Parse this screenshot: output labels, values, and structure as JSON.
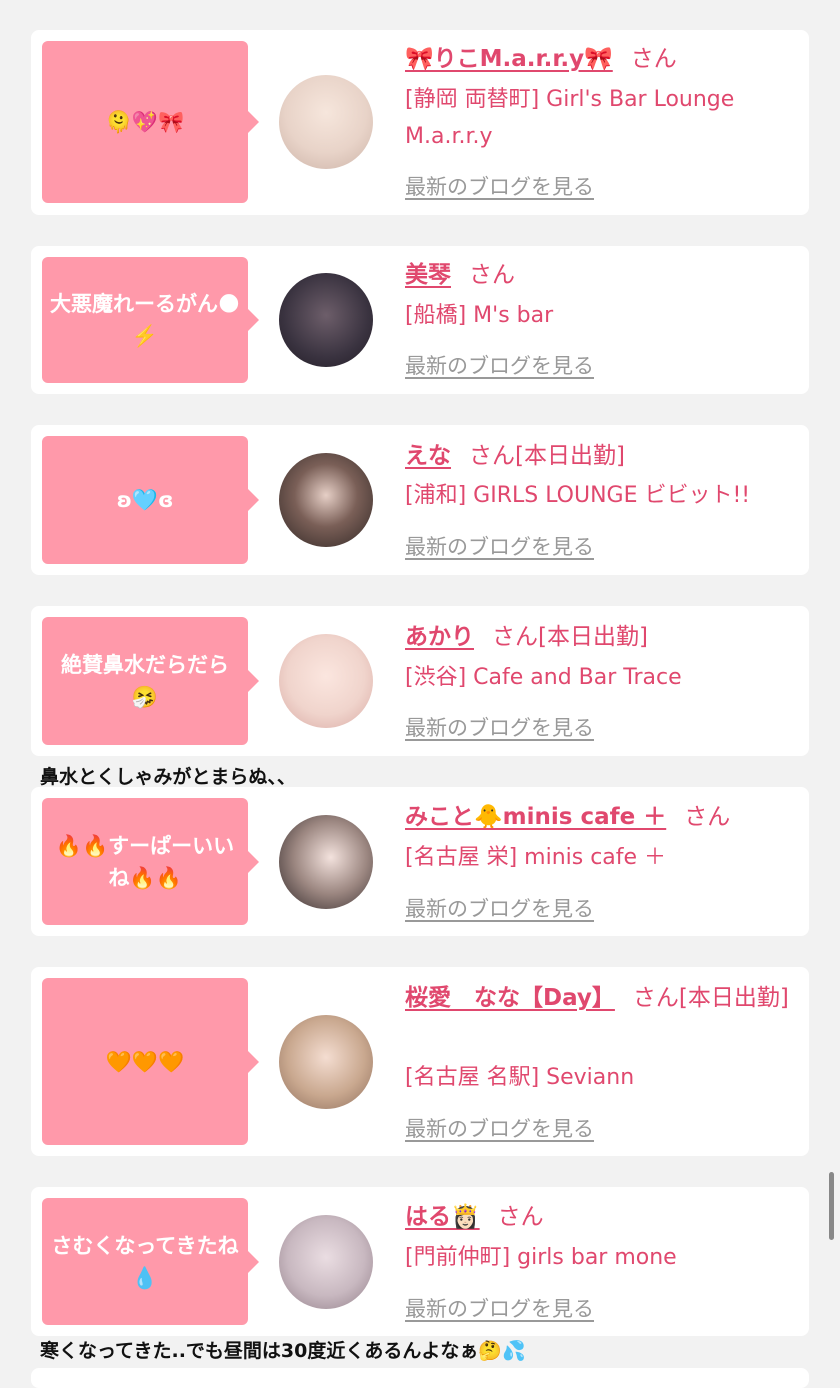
{
  "entries": [
    {
      "bubble": "🫠💖🎀",
      "name": "🎀りこM.a.r.r.y🎀",
      "suffix": "さん",
      "shop": "[静岡 両替町] Girl's Bar Lounge M.a.r.r.y",
      "blog": "最新のブログを見る",
      "avatar": "#e8d3c8"
    },
    {
      "bubble": "大悪魔れーるがん🌑⚡️",
      "name": "美琴",
      "suffix": "さん",
      "shop": "[船橋] M's bar",
      "blog": "最新のブログを見る",
      "avatar": "#3a3340"
    },
    {
      "bubble": "ʚ🩵ɞ",
      "name": "えな",
      "suffix": "さん[本日出勤]",
      "shop": "[浦和] GIRLS LOUNGE ビビット!!",
      "blog": "最新のブログを見る",
      "avatar": "#4a3a36"
    },
    {
      "bubble": "絶賛鼻水だらだら🤧",
      "name": "あかり",
      "suffix": "さん[本日出勤]",
      "shop": "[渋谷] Cafe and Bar Trace",
      "blog": "最新のブログを見る",
      "avatar": "#f0d4cc",
      "comment": "鼻水とくしゃみがとまらぬ、、"
    },
    {
      "bubble": "🔥🔥すーぱーいいね🔥🔥",
      "name": "みこと🐥minis cafe ＋",
      "suffix": "さん",
      "shop": "[名古屋 栄] minis cafe ＋",
      "blog": "最新のブログを見る",
      "avatar": "#d9c9c4"
    },
    {
      "bubble": "🧡🧡🧡",
      "name": "桜愛　なな【Day】",
      "suffix": "さん[本日出勤]",
      "shop": "[名古屋 名駅] Seviann",
      "blog": "最新のブログを見る",
      "avatar": "#c9a88f"
    },
    {
      "bubble": "さむくなってきたね💧",
      "name": "はる👸🏻",
      "suffix": "さん",
      "shop": "[門前仲町] girls bar mone",
      "blog": "最新のブログを見る",
      "avatar": "#c8b8c0",
      "comment": "寒くなってきた..でも昼間は30度近くあるんよなぁ🤔💦"
    }
  ]
}
